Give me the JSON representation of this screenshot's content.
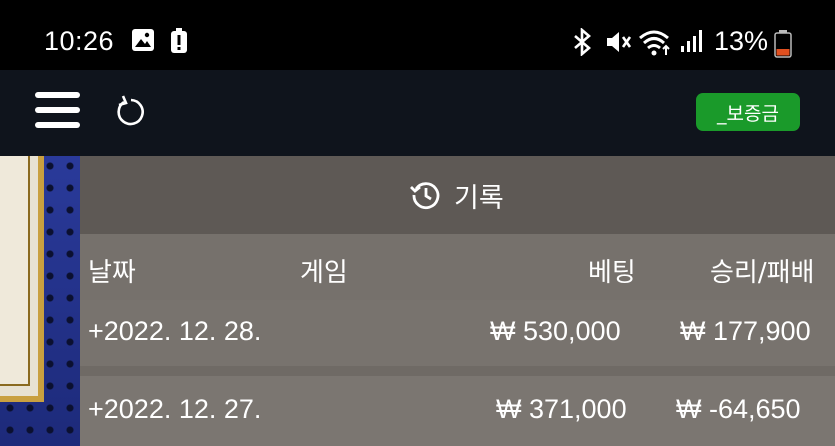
{
  "status_bar": {
    "time": "10:26",
    "battery_percent": "13%",
    "icons": [
      "image-icon",
      "alert-icon",
      "bluetooth-icon",
      "mute-icon",
      "wifi-icon",
      "signal-icon",
      "battery-icon"
    ]
  },
  "app_bar": {
    "menu_icon": "menu-icon",
    "refresh_icon": "refresh-icon",
    "deposit_label": "_보증금",
    "accent_color": "#1a9a2a"
  },
  "history": {
    "title": "기록",
    "icon": "history-icon",
    "columns": {
      "date": "날짜",
      "game": "게임",
      "bet": "베팅",
      "win_loss": "승리/패배"
    },
    "rows": [
      {
        "date": "+2022. 12. 28.",
        "game": "",
        "bet": "₩ 530,000",
        "win_loss": "₩ 177,900"
      },
      {
        "date": "+2022. 12. 27.",
        "game": "",
        "bet": "₩ 371,000",
        "win_loss": "₩ -64,650"
      }
    ]
  }
}
